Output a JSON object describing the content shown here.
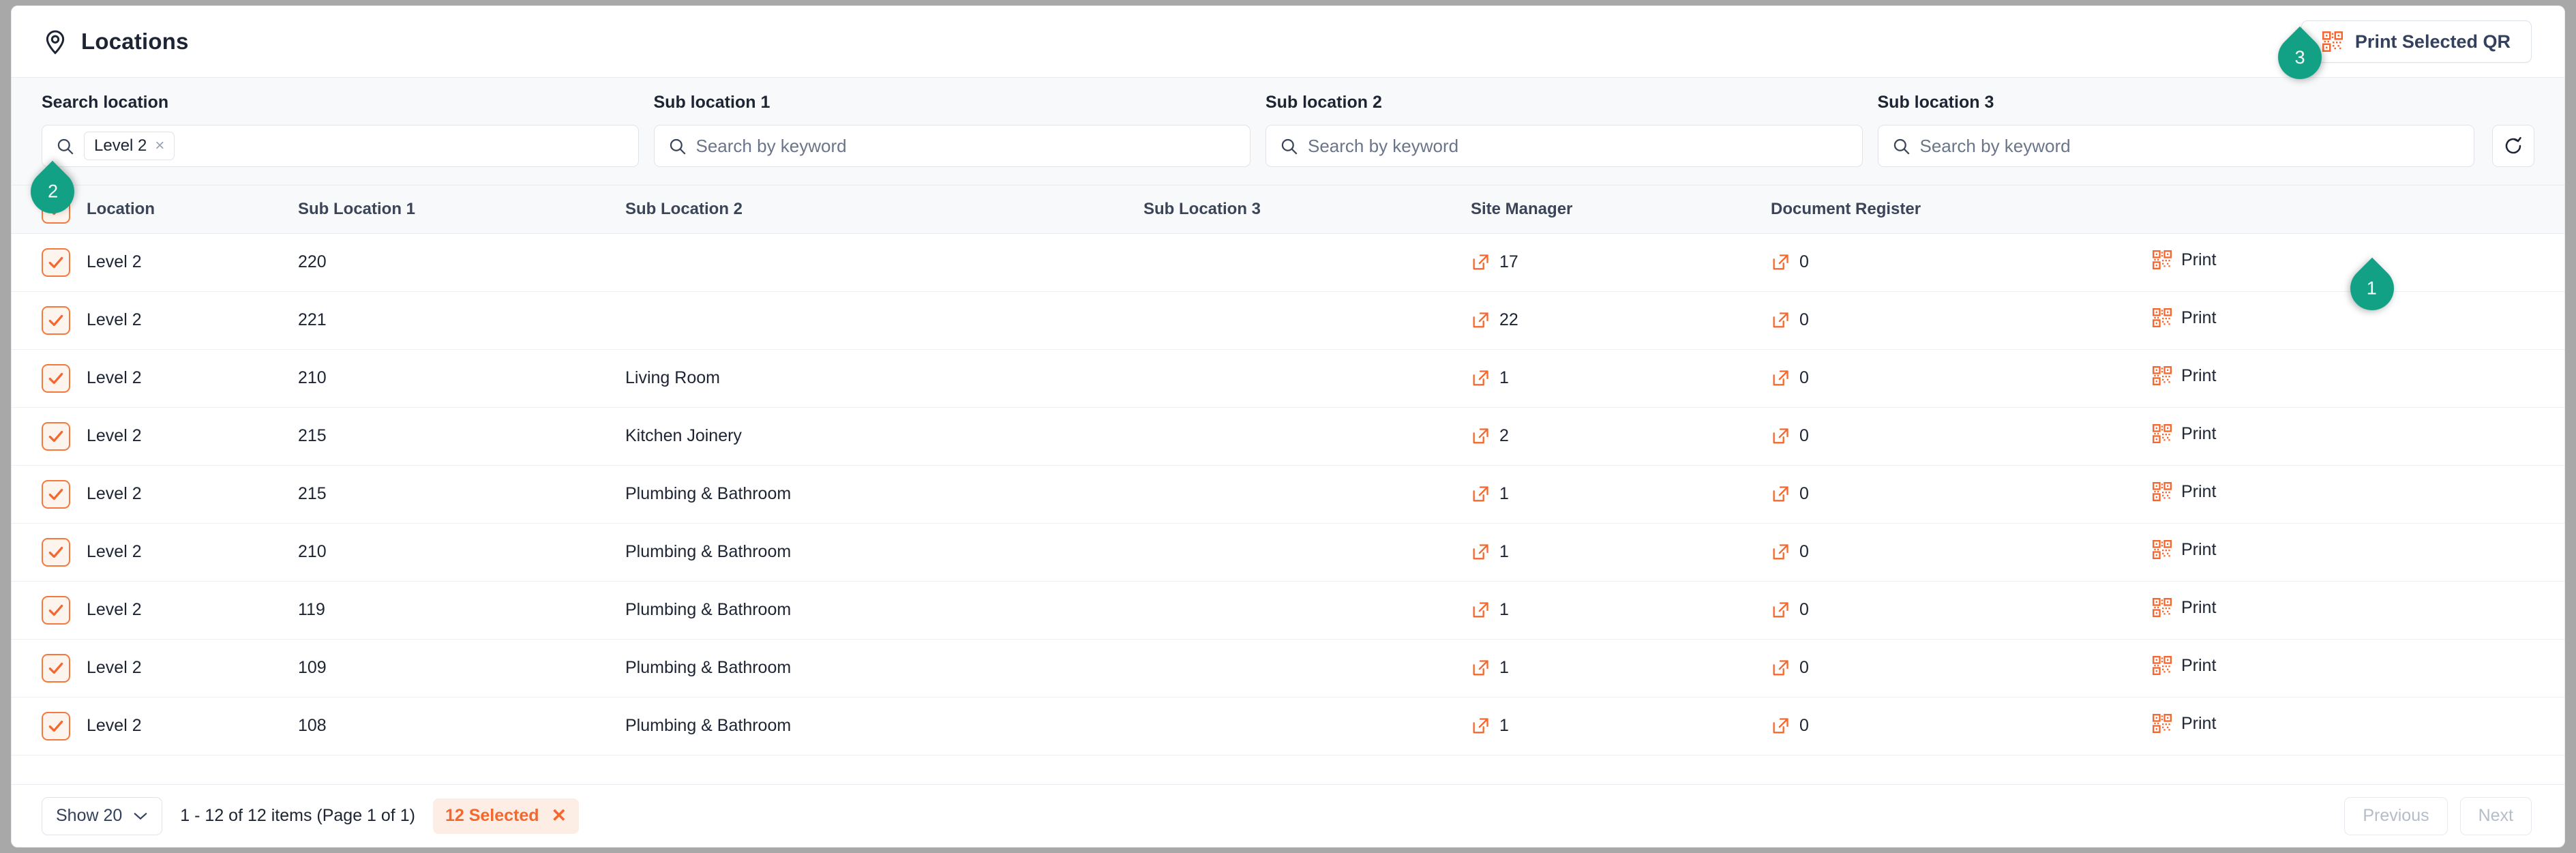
{
  "header": {
    "title": "Locations",
    "pin_icon": "location-pin-icon",
    "print_selected_qr_label": "Print Selected QR",
    "print_selected_qr_icon": "qr-code-icon"
  },
  "badges": [
    {
      "id": "1",
      "label": "1",
      "color": "#13a185",
      "points": "left"
    },
    {
      "id": "2",
      "label": "2",
      "color": "#13a185",
      "points": "down"
    },
    {
      "id": "3",
      "label": "3",
      "color": "#13a185",
      "points": "right"
    }
  ],
  "filters": {
    "search_location": {
      "label": "Search location",
      "icon": "search-icon",
      "chip": {
        "text": "Level 2",
        "remove": "×"
      },
      "placeholder": ""
    },
    "sub_location_1": {
      "label": "Sub location 1",
      "icon": "search-icon",
      "placeholder": "Search by keyword",
      "value": ""
    },
    "sub_location_2": {
      "label": "Sub location 2",
      "icon": "search-icon",
      "placeholder": "Search by keyword",
      "value": ""
    },
    "sub_location_3": {
      "label": "Sub location 3",
      "icon": "search-icon",
      "placeholder": "Search by keyword",
      "value": ""
    },
    "refresh_icon": "refresh-icon"
  },
  "table": {
    "select_all_checked": true,
    "columns": [
      "Location",
      "Sub Location 1",
      "Sub Location 2",
      "Sub Location 3",
      "Site Manager",
      "Document Register",
      ""
    ],
    "print_label": "Print",
    "rows": [
      {
        "checked": true,
        "location": "Level 2",
        "sub1": "220",
        "sub2": "",
        "sub3": "",
        "site_manager": "17",
        "document_register": "0",
        "print": "Print"
      },
      {
        "checked": true,
        "location": "Level 2",
        "sub1": "221",
        "sub2": "",
        "sub3": "",
        "site_manager": "22",
        "document_register": "0",
        "print": "Print"
      },
      {
        "checked": true,
        "location": "Level 2",
        "sub1": "210",
        "sub2": "Living Room",
        "sub3": "",
        "site_manager": "1",
        "document_register": "0",
        "print": "Print"
      },
      {
        "checked": true,
        "location": "Level 2",
        "sub1": "215",
        "sub2": "Kitchen Joinery",
        "sub3": "",
        "site_manager": "2",
        "document_register": "0",
        "print": "Print"
      },
      {
        "checked": true,
        "location": "Level 2",
        "sub1": "215",
        "sub2": "Plumbing & Bathroom",
        "sub3": "",
        "site_manager": "1",
        "document_register": "0",
        "print": "Print"
      },
      {
        "checked": true,
        "location": "Level 2",
        "sub1": "210",
        "sub2": "Plumbing & Bathroom",
        "sub3": "",
        "site_manager": "1",
        "document_register": "0",
        "print": "Print"
      },
      {
        "checked": true,
        "location": "Level 2",
        "sub1": "119",
        "sub2": "Plumbing & Bathroom",
        "sub3": "",
        "site_manager": "1",
        "document_register": "0",
        "print": "Print"
      },
      {
        "checked": true,
        "location": "Level 2",
        "sub1": "109",
        "sub2": "Plumbing & Bathroom",
        "sub3": "",
        "site_manager": "1",
        "document_register": "0",
        "print": "Print"
      },
      {
        "checked": true,
        "location": "Level 2",
        "sub1": "108",
        "sub2": "Plumbing & Bathroom",
        "sub3": "",
        "site_manager": "1",
        "document_register": "0",
        "print": "Print"
      }
    ]
  },
  "footer": {
    "page_size_label": "Show 20",
    "page_size_icon": "chevron-down-icon",
    "pager_info": "1 - 12 of 12 items (Page 1 of 1)",
    "selected_label": "12 Selected",
    "selected_clear": "✕",
    "previous_label": "Previous",
    "next_label": "Next"
  },
  "colors": {
    "accent_orange": "#f4682f",
    "badge_teal": "#13a185",
    "text_dark": "#1d2433",
    "panel_bg": "#f8f9fb",
    "selected_pill_bg": "#fdeee5"
  }
}
